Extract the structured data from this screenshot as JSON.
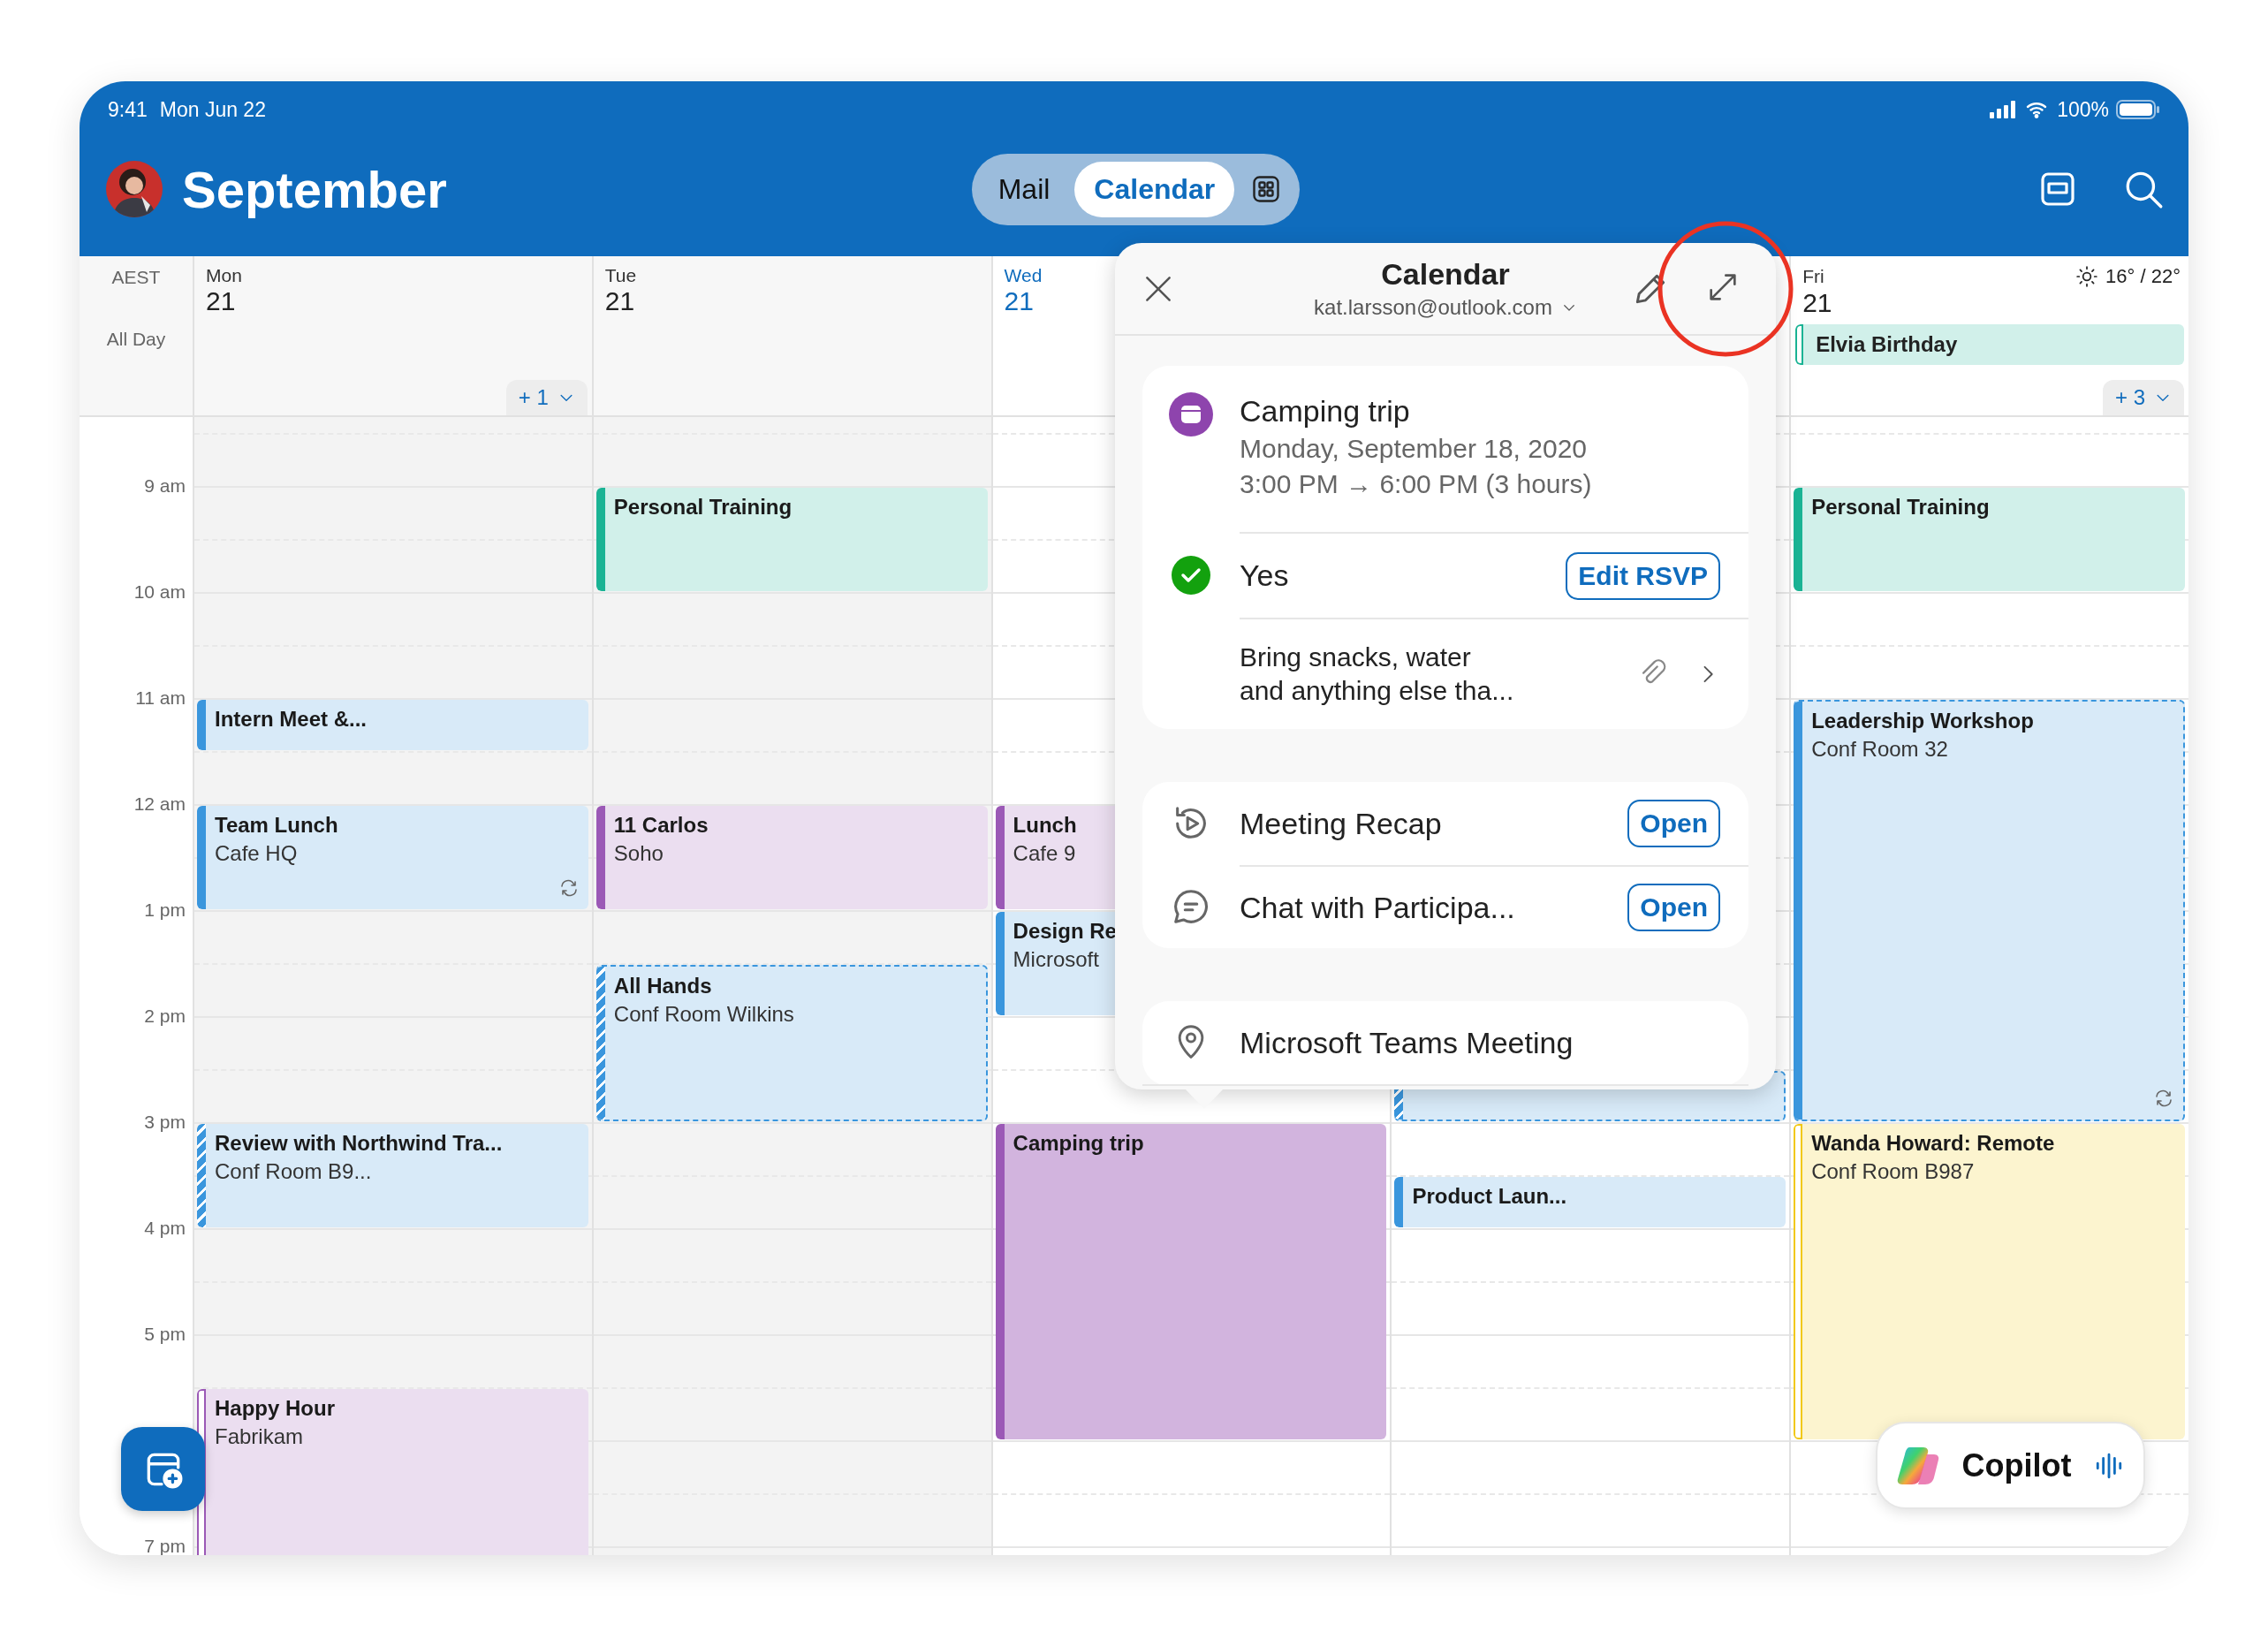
{
  "status_bar": {
    "time": "9:41",
    "date": "Mon Jun 22",
    "battery": "100%"
  },
  "header": {
    "title": "September",
    "tabs": [
      {
        "label": "Mail",
        "selected": false
      },
      {
        "label": "Calendar",
        "selected": true
      }
    ]
  },
  "calendar": {
    "timezone": "AEST",
    "all_day_label": "All Day",
    "hours": [
      "9 am",
      "10 am",
      "11 am",
      "12 am",
      "1 pm",
      "2 pm",
      "3 pm",
      "4 pm",
      "5 pm",
      "7 pm"
    ],
    "days": [
      {
        "name": "Mon",
        "date": "21",
        "today": false,
        "shaded": true,
        "more": "+ 1",
        "events": [
          {
            "title": "Intern Meet &...",
            "kind": "busy",
            "dashed": false,
            "recurring": false,
            "selected": false,
            "color": "#3a96dd"
          },
          {
            "title": "Team Lunch",
            "location": "Cafe HQ",
            "kind": "busy",
            "dashed": false,
            "recurring": true,
            "selected": false,
            "color": "#3a96dd"
          },
          {
            "title": "Review with Northwind Tra...",
            "location": "Conf Room B9...",
            "kind": "tentative",
            "dashed": false,
            "recurring": false,
            "selected": false,
            "color": "#3a96dd"
          },
          {
            "title": "Happy Hour",
            "location": "Fabrikam",
            "kind": "free",
            "dashed": false,
            "selected": false,
            "color": "#9b59b6"
          }
        ]
      },
      {
        "name": "Tue",
        "date": "21",
        "today": false,
        "shaded": true,
        "events": [
          {
            "title": "Personal Training",
            "kind": "busy",
            "dashed": false,
            "recurring": false,
            "selected": false,
            "color": "#1ab394"
          },
          {
            "title": "11 Carlos",
            "location": "Soho",
            "kind": "busy",
            "dashed": false,
            "recurring": false,
            "selected": false,
            "color": "#9b59b6"
          },
          {
            "title": "All Hands",
            "location": "Conf Room Wilkins",
            "kind": "tentative",
            "dashed": true,
            "recurring": false,
            "selected": false,
            "color": "#3a96dd"
          }
        ]
      },
      {
        "name": "Wed",
        "date": "21",
        "today": true,
        "shaded": false,
        "events": [
          {
            "title": "Lunch",
            "location": "Cafe 9",
            "kind": "busy",
            "dashed": false,
            "selected": false,
            "color": "#9b59b6"
          },
          {
            "title": "Design Re",
            "location": "Microsoft",
            "kind": "busy",
            "dashed": false,
            "selected": false,
            "color": "#3a96dd"
          },
          {
            "title": "Camping trip",
            "kind": "busy",
            "dashed": false,
            "recurring": false,
            "selected": true,
            "color": "#9b59b6"
          }
        ]
      },
      {
        "shaded": false,
        "events": [
          {
            "kind": "tentative",
            "dashed": true,
            "selected": false,
            "color": "#3a96dd"
          },
          {
            "title": "Product Laun...",
            "kind": "busy",
            "dashed": false,
            "recurring": false,
            "selected": false,
            "color": "#3a96dd"
          }
        ]
      },
      {
        "name": "Fri",
        "date": "21",
        "today": false,
        "shaded": false,
        "weather": "16° / 22°",
        "more": "+ 3",
        "all_day": [
          {
            "title": "Elvia Birthday",
            "kind": "free",
            "color": "#1ab394"
          }
        ],
        "events": [
          {
            "title": "Personal Training",
            "kind": "busy",
            "dashed": false,
            "recurring": false,
            "selected": false,
            "color": "#1ab394"
          },
          {
            "title": "Leadership Workshop",
            "location": "Conf Room 32",
            "kind": "busy",
            "dashed": true,
            "recurring": true,
            "selected": false,
            "color": "#3a96dd"
          },
          {
            "title": "Wanda Howard: Remote",
            "location": "Conf Room B987",
            "kind": "free",
            "dashed": false,
            "recurring": false,
            "selected": false,
            "color": "#f2c811"
          }
        ]
      }
    ]
  },
  "event_popover": {
    "calendar": "Calendar",
    "account": "kat.larsson@outlook.com",
    "title": "Camping trip",
    "date": "Monday, September 18, 2020",
    "time": "3:00 PM → 6:00 PM (3 hours)",
    "rsvp": {
      "response": "Yes",
      "button": "Edit RSVP"
    },
    "notes": "Bring snacks, water\nand anything else tha...",
    "actions": [
      {
        "kind": "recap",
        "label": "Meeting Recap",
        "button": "Open"
      },
      {
        "kind": "chat",
        "label": "Chat with Participa...",
        "button": "Open"
      }
    ],
    "location": "Microsoft Teams Meeting"
  },
  "copilot": {
    "label": "Copilot"
  }
}
